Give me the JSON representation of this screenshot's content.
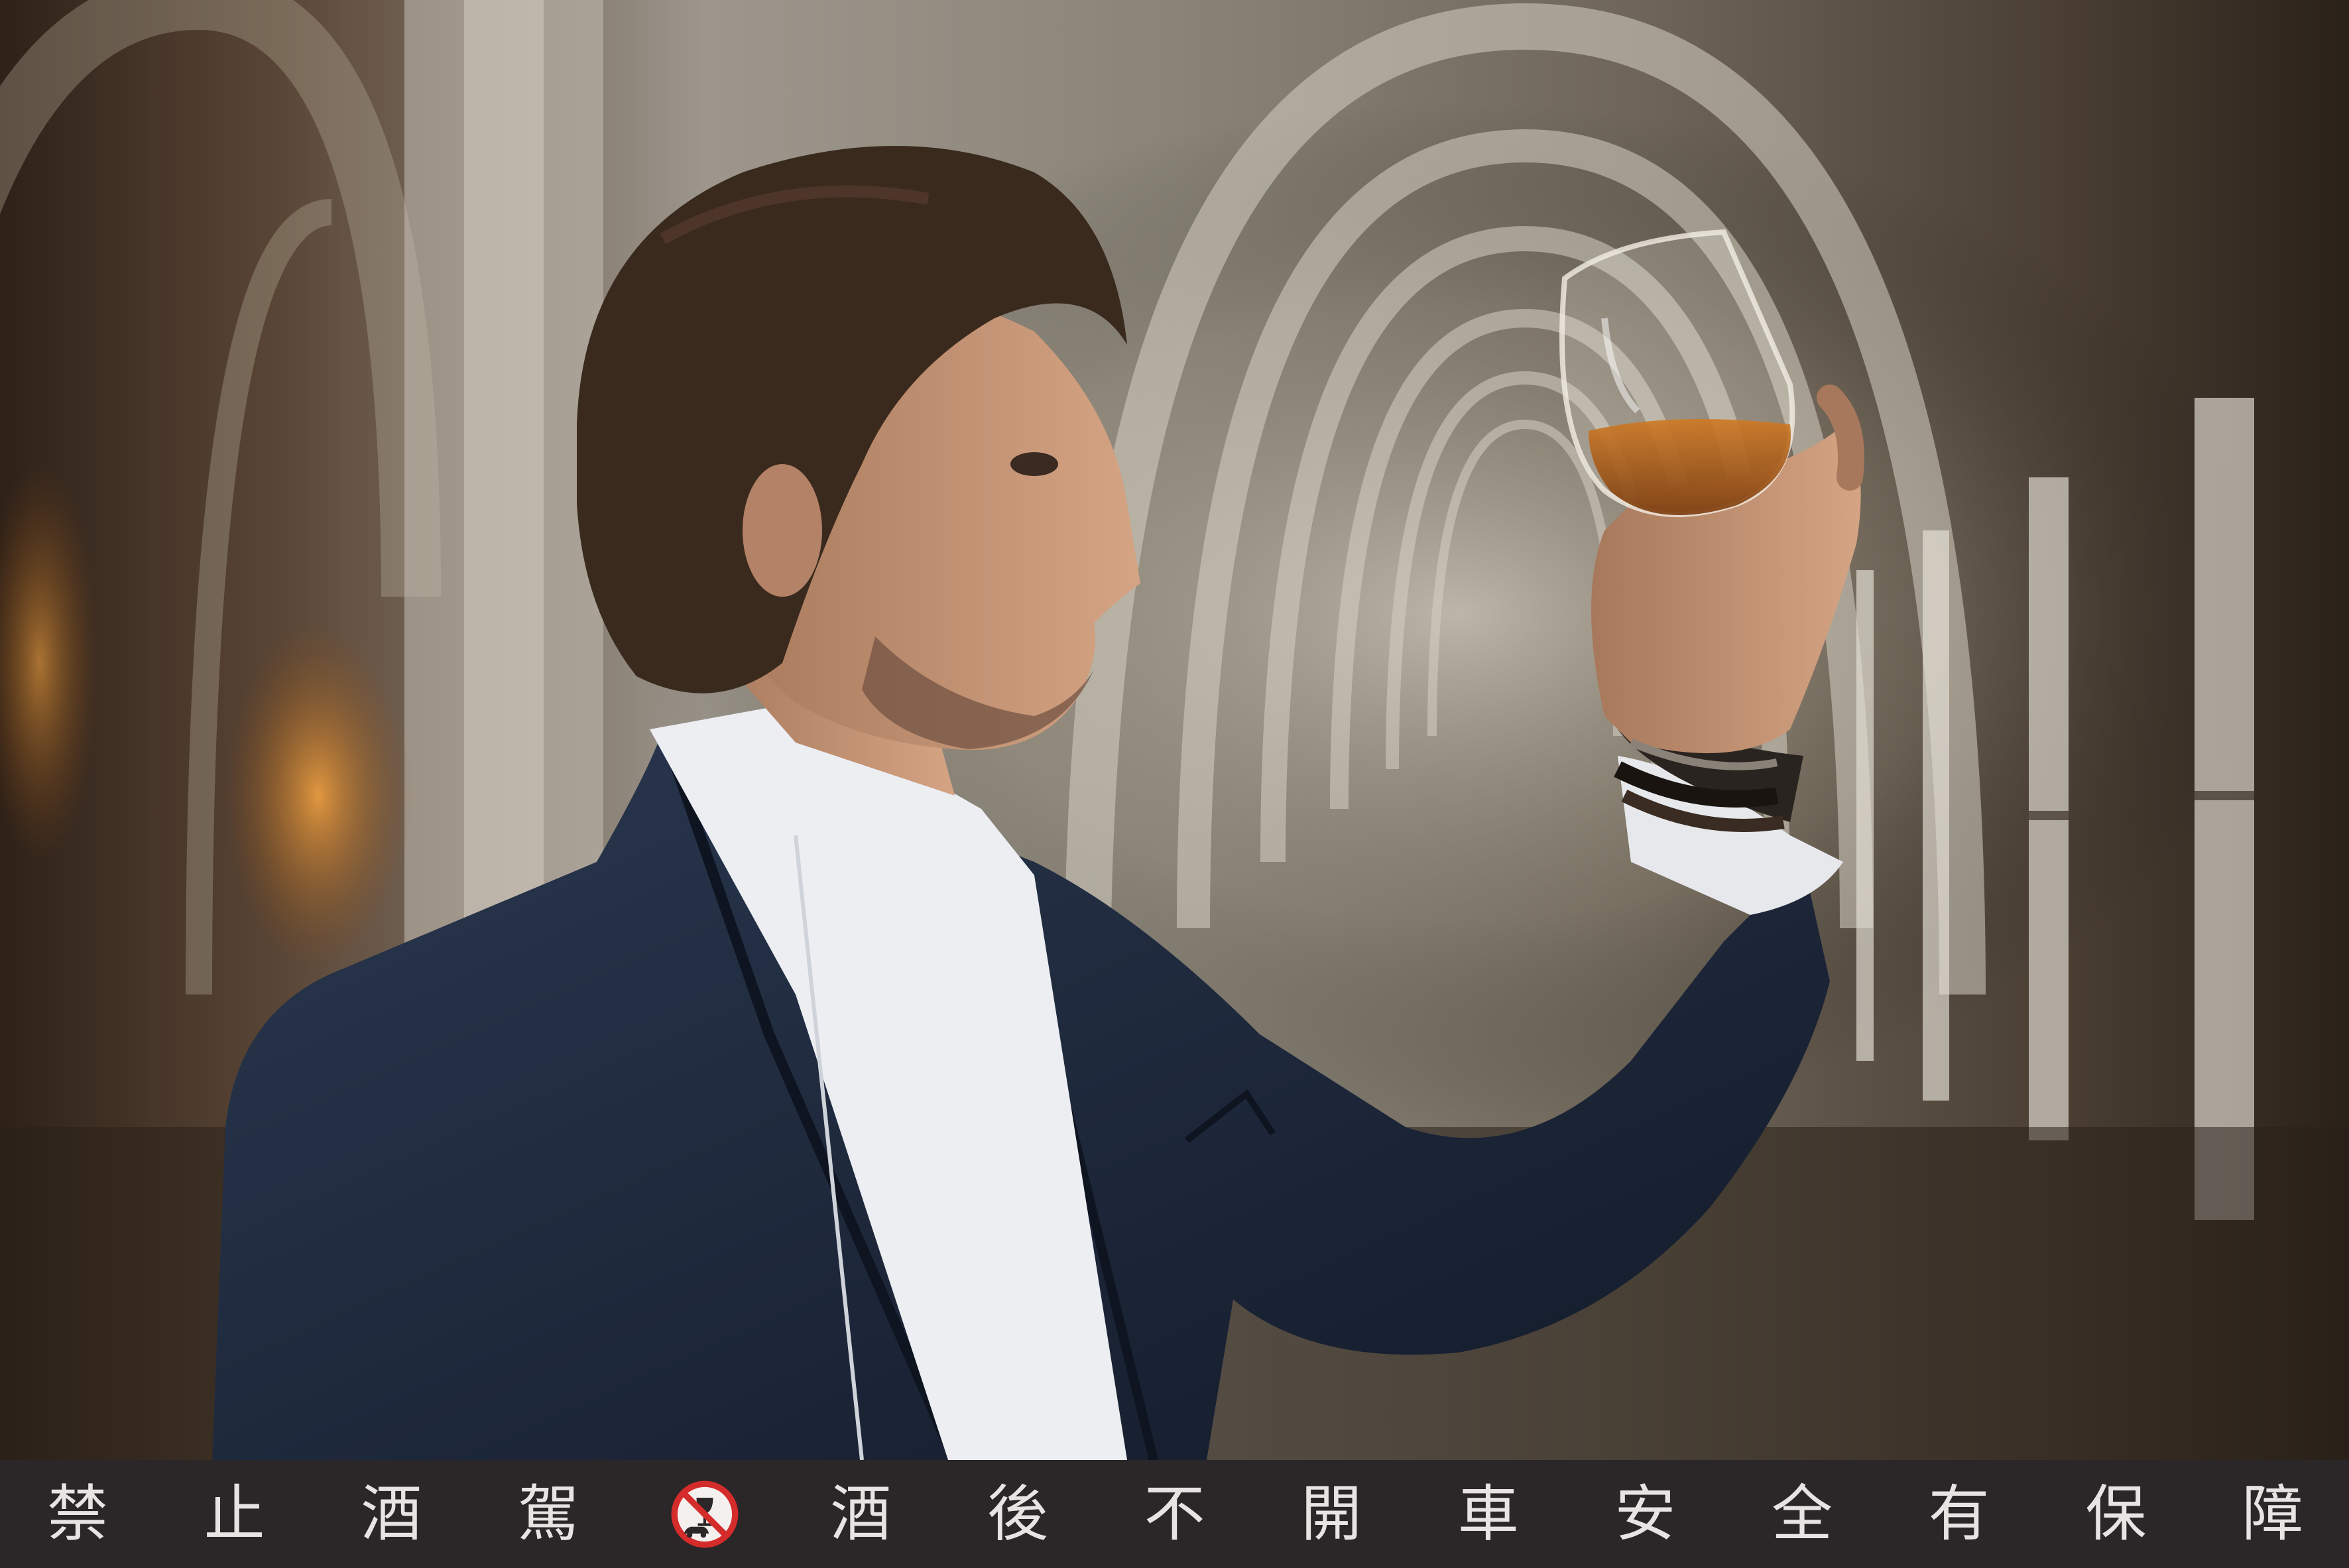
{
  "photo": {
    "subject": "man-examining-glass-of-amber-spirit",
    "setting": "arched-cellar-corridor",
    "palette": {
      "jacket": "#1e2a3c",
      "shirt": "#eef0f2",
      "hair": "#3a2a1e",
      "skin": "#c89a7c",
      "liquor": "#b8651c",
      "stone": "#9a9286",
      "warm_light": "#d08a3a"
    }
  },
  "warning_bar": {
    "background": "#2b2627",
    "text_color": "#e8e4e3",
    "accent_color": "#d42b2b",
    "chars_left": [
      "禁",
      "止",
      "酒",
      "駕"
    ],
    "icon": "no-drink-driving-icon",
    "chars_right": [
      "酒",
      "後",
      "不",
      "開",
      "車",
      "安",
      "全",
      "有",
      "保",
      "障"
    ]
  }
}
